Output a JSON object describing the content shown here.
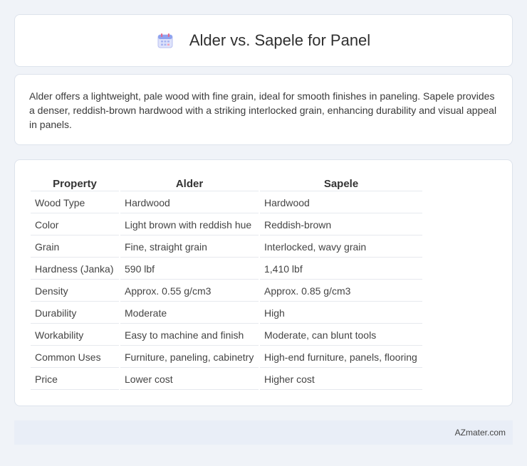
{
  "header": {
    "title": "Alder vs. Sapele for Panel",
    "icon": "calendar-icon"
  },
  "summary": {
    "text": "Alder offers a lightweight, pale wood with fine grain, ideal for smooth finishes in paneling. Sapele provides a denser, reddish-brown hardwood with a striking interlocked grain, enhancing durability and visual appeal in panels."
  },
  "table": {
    "headers": [
      "Property",
      "Alder",
      "Sapele"
    ],
    "rows": [
      [
        "Wood Type",
        "Hardwood",
        "Hardwood"
      ],
      [
        "Color",
        "Light brown with reddish hue",
        "Reddish-brown"
      ],
      [
        "Grain",
        "Fine, straight grain",
        "Interlocked, wavy grain"
      ],
      [
        "Hardness (Janka)",
        "590 lbf",
        "1,410 lbf"
      ],
      [
        "Density",
        "Approx. 0.55 g/cm3",
        "Approx. 0.85 g/cm3"
      ],
      [
        "Durability",
        "Moderate",
        "High"
      ],
      [
        "Workability",
        "Easy to machine and finish",
        "Moderate, can blunt tools"
      ],
      [
        "Common Uses",
        "Furniture, paneling, cabinetry",
        "High-end furniture, panels, flooring"
      ],
      [
        "Price",
        "Lower cost",
        "Higher cost"
      ]
    ]
  },
  "footer": {
    "text": "AZmater.com"
  },
  "colors": {
    "background": "#f0f3f8",
    "card": "#ffffff",
    "footer": "#e9eef7"
  }
}
